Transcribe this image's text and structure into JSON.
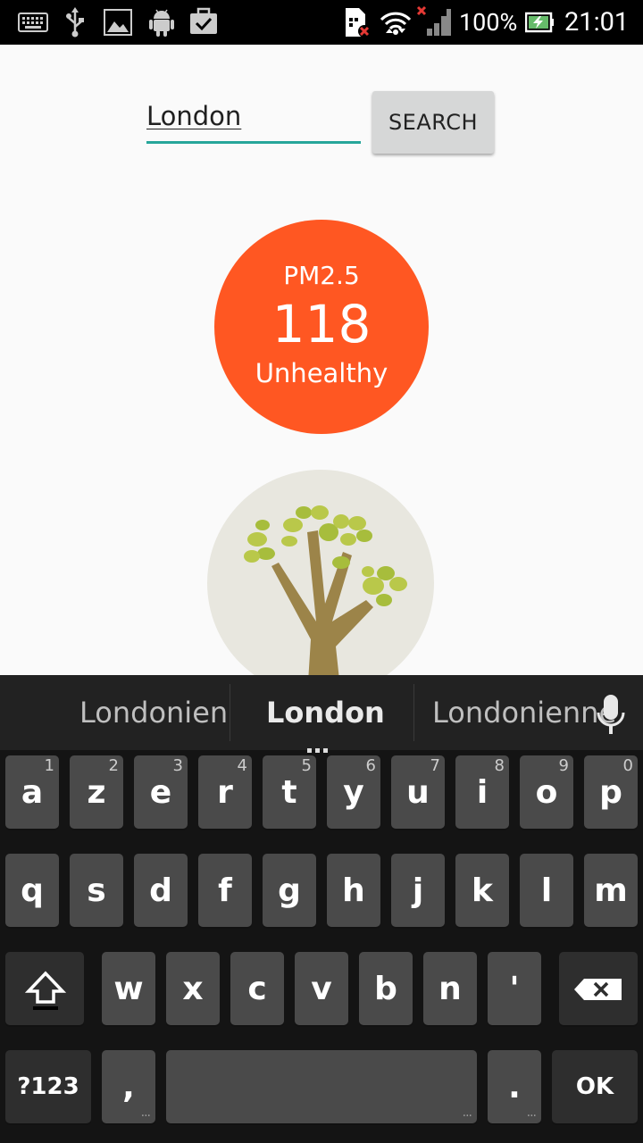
{
  "status_bar": {
    "battery_percent": "100%",
    "time": "21:01"
  },
  "search": {
    "value": "London",
    "button_label": "SEARCH"
  },
  "aqi": {
    "label": "PM2.5",
    "value": "118",
    "status": "Unhealthy",
    "color": "#ff5722"
  },
  "keyboard": {
    "suggestions": [
      "Londonien",
      "London",
      "Londonienne"
    ],
    "row1": [
      {
        "k": "a",
        "n": "1"
      },
      {
        "k": "z",
        "n": "2"
      },
      {
        "k": "e",
        "n": "3"
      },
      {
        "k": "r",
        "n": "4"
      },
      {
        "k": "t",
        "n": "5"
      },
      {
        "k": "y",
        "n": "6"
      },
      {
        "k": "u",
        "n": "7"
      },
      {
        "k": "i",
        "n": "8"
      },
      {
        "k": "o",
        "n": "9"
      },
      {
        "k": "p",
        "n": "0"
      }
    ],
    "row2": [
      "q",
      "s",
      "d",
      "f",
      "g",
      "h",
      "j",
      "k",
      "l",
      "m"
    ],
    "row3": [
      "w",
      "x",
      "c",
      "v",
      "b",
      "n",
      "'"
    ],
    "symbols_label": "?123",
    "comma_label": ",",
    "period_label": ".",
    "ok_label": "OK"
  }
}
